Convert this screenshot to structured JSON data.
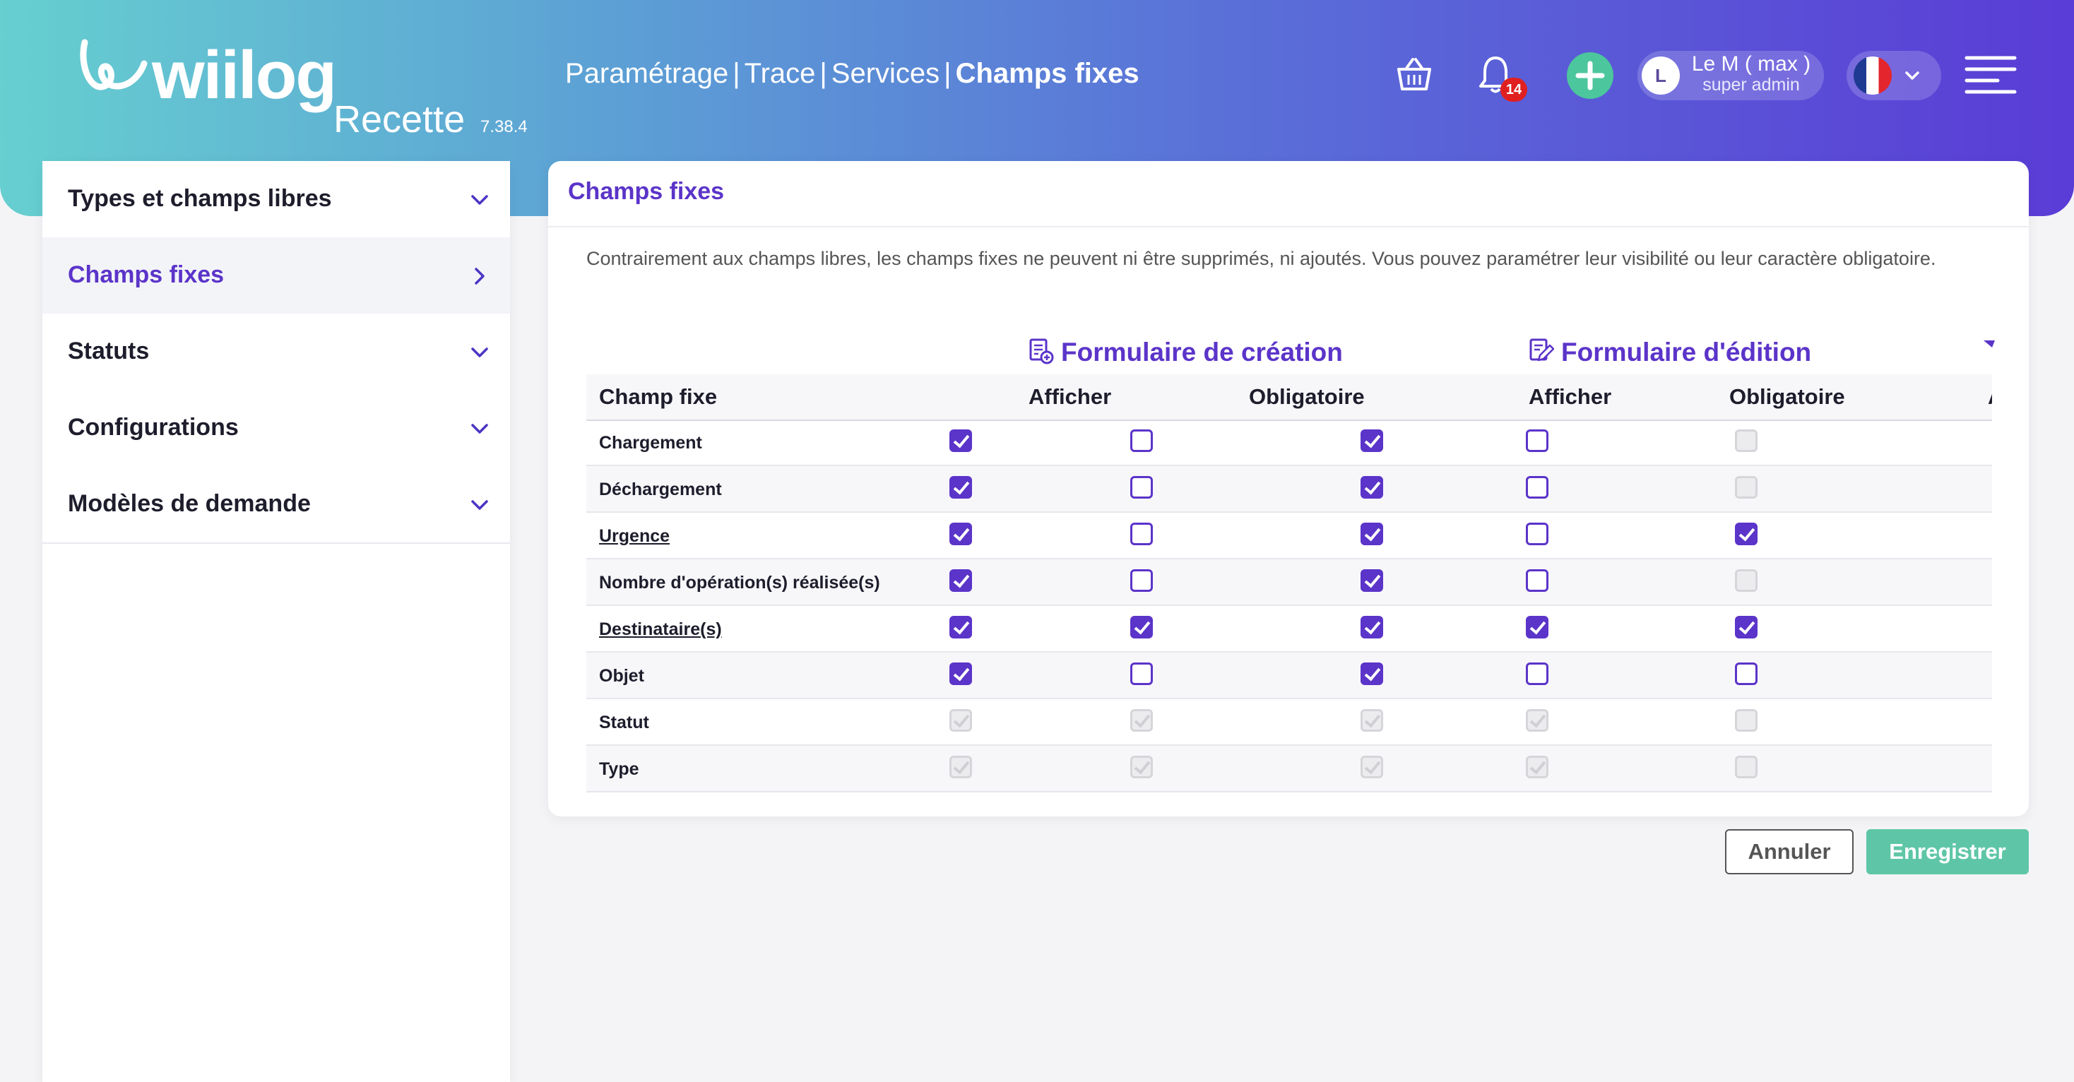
{
  "header": {
    "brand": "wiilog",
    "environment": "Recette",
    "version": "7.38.4",
    "breadcrumb": [
      "Paramétrage",
      "Trace",
      "Services",
      "Champs fixes"
    ],
    "notification_count": "14",
    "user": {
      "initial": "L",
      "name": "Le M ( max )",
      "role": "super admin"
    },
    "language_flag": "fr-flag-icon"
  },
  "sidebar": {
    "items": [
      {
        "label": "Types et champs libres",
        "icon": "chevron-down-icon",
        "active": false
      },
      {
        "label": "Champs fixes",
        "icon": "chevron-right-icon",
        "active": true
      },
      {
        "label": "Statuts",
        "icon": "chevron-down-icon",
        "active": false
      },
      {
        "label": "Configurations",
        "icon": "chevron-down-icon",
        "active": false
      },
      {
        "label": "Modèles de demande",
        "icon": "chevron-down-icon",
        "active": false
      }
    ]
  },
  "main": {
    "title": "Champs fixes",
    "description": "Contrairement aux champs libres, les champs fixes ne peuvent ni être supprimés, ni ajoutés. Vous pouvez paramétrer leur visibilité ou leur caractère obligatoire.",
    "groups": [
      {
        "title": "Formulaire de création",
        "icon": "form-create-icon"
      },
      {
        "title": "Formulaire d'édition",
        "icon": "form-edit-icon"
      }
    ],
    "columns": [
      "Champ fixe",
      "Afficher",
      "Obligatoire",
      "Afficher",
      "Obligatoire",
      "A"
    ],
    "rows": [
      {
        "label": "Chargement",
        "underline": false,
        "checks": [
          {
            "checked": true,
            "disabled": false
          },
          {
            "checked": false,
            "disabled": false
          },
          {
            "checked": true,
            "disabled": false
          },
          {
            "checked": false,
            "disabled": false
          },
          {
            "checked": false,
            "disabled": true
          }
        ]
      },
      {
        "label": "Déchargement",
        "underline": false,
        "checks": [
          {
            "checked": true,
            "disabled": false
          },
          {
            "checked": false,
            "disabled": false
          },
          {
            "checked": true,
            "disabled": false
          },
          {
            "checked": false,
            "disabled": false
          },
          {
            "checked": false,
            "disabled": true
          }
        ]
      },
      {
        "label": "Urgence",
        "underline": true,
        "checks": [
          {
            "checked": true,
            "disabled": false
          },
          {
            "checked": false,
            "disabled": false
          },
          {
            "checked": true,
            "disabled": false
          },
          {
            "checked": false,
            "disabled": false
          },
          {
            "checked": true,
            "disabled": false
          }
        ]
      },
      {
        "label": "Nombre d'opération(s) réalisée(s)",
        "underline": false,
        "checks": [
          {
            "checked": true,
            "disabled": false
          },
          {
            "checked": false,
            "disabled": false
          },
          {
            "checked": true,
            "disabled": false
          },
          {
            "checked": false,
            "disabled": false
          },
          {
            "checked": false,
            "disabled": true
          }
        ]
      },
      {
        "label": "Destinataire(s)",
        "underline": true,
        "checks": [
          {
            "checked": true,
            "disabled": false
          },
          {
            "checked": true,
            "disabled": false
          },
          {
            "checked": true,
            "disabled": false
          },
          {
            "checked": true,
            "disabled": false
          },
          {
            "checked": true,
            "disabled": false
          }
        ]
      },
      {
        "label": "Objet",
        "underline": false,
        "checks": [
          {
            "checked": true,
            "disabled": false
          },
          {
            "checked": false,
            "disabled": false
          },
          {
            "checked": true,
            "disabled": false
          },
          {
            "checked": false,
            "disabled": false
          },
          {
            "checked": false,
            "disabled": false
          }
        ]
      },
      {
        "label": "Statut",
        "underline": false,
        "checks": [
          {
            "checked": true,
            "disabled": true
          },
          {
            "checked": true,
            "disabled": true
          },
          {
            "checked": true,
            "disabled": true
          },
          {
            "checked": true,
            "disabled": true
          },
          {
            "checked": false,
            "disabled": true
          }
        ]
      },
      {
        "label": "Type",
        "underline": false,
        "checks": [
          {
            "checked": true,
            "disabled": true
          },
          {
            "checked": true,
            "disabled": true
          },
          {
            "checked": true,
            "disabled": true
          },
          {
            "checked": true,
            "disabled": true
          },
          {
            "checked": false,
            "disabled": true
          }
        ]
      }
    ],
    "buttons": {
      "cancel": "Annuler",
      "save": "Enregistrer"
    }
  },
  "colors": {
    "accent": "#5b34c9",
    "save": "#5ec6a6",
    "plus": "#4cc69c",
    "badge": "#e02020"
  }
}
